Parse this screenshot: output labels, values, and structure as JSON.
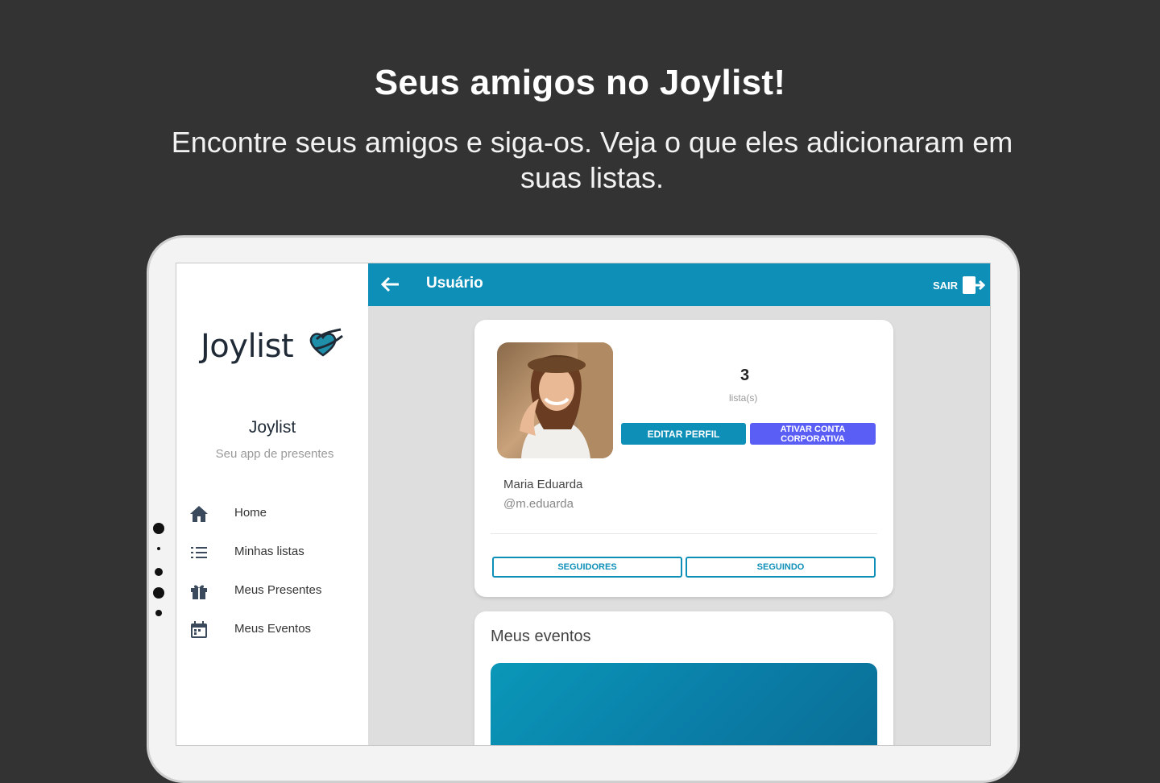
{
  "headline": "Seus amigos no Joylist!",
  "subline": "Encontre seus amigos e siga-os. Veja o que eles adicionaram em suas listas.",
  "colors": {
    "background": "#333333",
    "primary": "#0d8fb8",
    "corporate": "#5b5ef5"
  },
  "sidebar": {
    "logo_text": "Joylist",
    "brand_name": "Joylist",
    "brand_tagline": "Seu app de presentes",
    "items": [
      {
        "label": "Home",
        "icon": "home-icon"
      },
      {
        "label": "Minhas listas",
        "icon": "list-icon"
      },
      {
        "label": "Meus Presentes",
        "icon": "gift-icon"
      },
      {
        "label": "Meus Eventos",
        "icon": "calendar-icon"
      }
    ]
  },
  "appbar": {
    "title": "Usuário",
    "logout_label": "SAIR",
    "back_icon": "arrow-left-icon",
    "logout_icon": "logout-icon"
  },
  "profile": {
    "list_count": "3",
    "list_count_label": "lista(s)",
    "edit_button": "EDITAR PERFIL",
    "corporate_button": "ATIVAR CONTA CORPORATIVA",
    "name": "Maria Eduarda",
    "handle": "@m.eduarda",
    "followers_button": "SEGUIDORES",
    "following_button": "SEGUINDO"
  },
  "events": {
    "title": "Meus eventos"
  }
}
